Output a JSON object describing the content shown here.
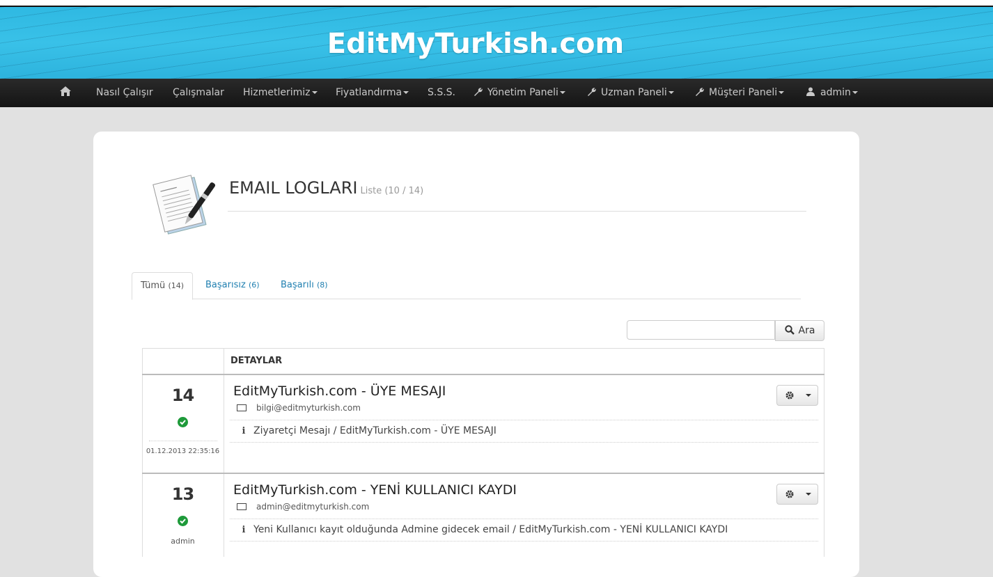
{
  "site": {
    "title": "EditMyTurkish.com"
  },
  "nav": {
    "home_icon": "home-icon",
    "items": [
      {
        "label": "Nasıl Çalışır",
        "dropdown": false
      },
      {
        "label": "Çalışmalar",
        "dropdown": false
      },
      {
        "label": "Hizmetlerimiz",
        "dropdown": true
      },
      {
        "label": "Fiyatlandırma",
        "dropdown": true
      },
      {
        "label": "S.S.S.",
        "dropdown": false
      },
      {
        "label": "Yönetim Paneli",
        "dropdown": true,
        "icon": "wrench-icon"
      },
      {
        "label": "Uzman Paneli",
        "dropdown": true,
        "icon": "wrench-icon"
      },
      {
        "label": "Müşteri Paneli",
        "dropdown": true,
        "icon": "wrench-icon"
      },
      {
        "label": "admin",
        "dropdown": true,
        "icon": "user-icon"
      }
    ]
  },
  "page": {
    "title": "EMAIL LOGLARI",
    "subtitle": "Liste (10 / 14)"
  },
  "tabs": [
    {
      "label": "Tümü",
      "count": "(14)",
      "active": true
    },
    {
      "label": "Başarısız",
      "count": "(6)",
      "active": false
    },
    {
      "label": "Başarılı",
      "count": "(8)",
      "active": false
    }
  ],
  "search": {
    "button_label": "Ara",
    "value": ""
  },
  "table": {
    "header": "DETAYLAR",
    "rows": [
      {
        "id": "14",
        "status": "success",
        "date": "01.12.2013 22:35:16",
        "subject": "EditMyTurkish.com - ÜYE MESAJI",
        "email": "bilgi@editmyturkish.com",
        "info": "Ziyaretçi Mesajı / EditMyTurkish.com - ÜYE MESAJI"
      },
      {
        "id": "13",
        "status": "success",
        "sender": "admin",
        "subject": "EditMyTurkish.com - YENİ KULLANICI KAYDI",
        "email": "admin@editmyturkish.com",
        "info": "Yeni Kullanıcı kayıt olduğunda Admine gidecek email / EditMyTurkish.com - YENİ KULLANICI KAYDI"
      }
    ]
  },
  "colors": {
    "banner": "#39c1e8",
    "navbar": "#1c1c1c",
    "success": "#1e9a3a",
    "link": "#1f7fb0"
  }
}
